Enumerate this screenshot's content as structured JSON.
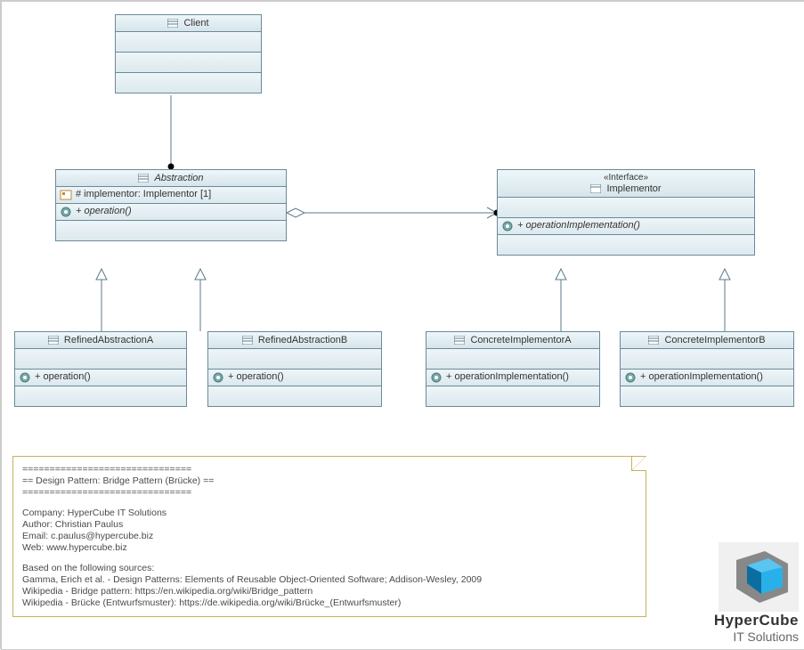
{
  "classes": {
    "client": {
      "name": "Client"
    },
    "abstraction": {
      "name": "Abstraction",
      "attr1": "# implementor: Implementor [1]",
      "op1": "+ operation()"
    },
    "implementor": {
      "stereo": "«Interface»",
      "name": "Implementor",
      "op1": "+ operationImplementation()"
    },
    "refinedA": {
      "name": "RefinedAbstractionA",
      "op1": "+ operation()"
    },
    "refinedB": {
      "name": "RefinedAbstractionB",
      "op1": "+ operation()"
    },
    "concreteA": {
      "name": "ConcreteImplementorA",
      "op1": "+ operationImplementation()"
    },
    "concreteB": {
      "name": "ConcreteImplementorB",
      "op1": "+ operationImplementation()"
    }
  },
  "note": {
    "line1": "===============================",
    "line2": "== Design Pattern: Bridge Pattern (Brücke) ==",
    "line3": "===============================",
    "line4": "Company: HyperCube IT Solutions",
    "line5": "Author: Christian Paulus",
    "line6": "Email: c.paulus@hypercube.biz",
    "line7": "Web: www.hypercube.biz",
    "line8": "Based on the following sources:",
    "line9": "Gamma, Erich et al. - Design Patterns: Elements of Reusable Object-Oriented Software; Addison-Wesley, 2009",
    "line10": "Wikipedia - Bridge pattern: https://en.wikipedia.org/wiki/Bridge_pattern",
    "line11": "Wikipedia - Brücke (Entwurfsmuster): https://de.wikipedia.org/wiki/Brücke_(Entwurfsmuster)"
  },
  "logo": {
    "line1": "HyperCube",
    "line2": "IT Solutions"
  },
  "chart_data": {
    "type": "uml-class-diagram",
    "pattern": "Bridge",
    "classes": [
      {
        "id": "Client",
        "stereotype": null,
        "abstract": false,
        "attributes": [],
        "operations": []
      },
      {
        "id": "Abstraction",
        "stereotype": null,
        "abstract": true,
        "attributes": [
          {
            "visibility": "#",
            "name": "implementor",
            "type": "Implementor",
            "multiplicity": "[1]"
          }
        ],
        "operations": [
          {
            "visibility": "+",
            "name": "operation()",
            "abstract": true
          }
        ]
      },
      {
        "id": "Implementor",
        "stereotype": "Interface",
        "abstract": true,
        "attributes": [],
        "operations": [
          {
            "visibility": "+",
            "name": "operationImplementation()",
            "abstract": true
          }
        ]
      },
      {
        "id": "RefinedAbstractionA",
        "stereotype": null,
        "abstract": false,
        "attributes": [],
        "operations": [
          {
            "visibility": "+",
            "name": "operation()"
          }
        ]
      },
      {
        "id": "RefinedAbstractionB",
        "stereotype": null,
        "abstract": false,
        "attributes": [],
        "operations": [
          {
            "visibility": "+",
            "name": "operation()"
          }
        ]
      },
      {
        "id": "ConcreteImplementorA",
        "stereotype": null,
        "abstract": false,
        "attributes": [],
        "operations": [
          {
            "visibility": "+",
            "name": "operationImplementation()"
          }
        ]
      },
      {
        "id": "ConcreteImplementorB",
        "stereotype": null,
        "abstract": false,
        "attributes": [],
        "operations": [
          {
            "visibility": "+",
            "name": "operationImplementation()"
          }
        ]
      }
    ],
    "relationships": [
      {
        "type": "association",
        "from": "Client",
        "to": "Abstraction",
        "navigable": true
      },
      {
        "type": "aggregation",
        "from": "Abstraction",
        "to": "Implementor",
        "navigable": true
      },
      {
        "type": "generalization",
        "from": "RefinedAbstractionA",
        "to": "Abstraction"
      },
      {
        "type": "generalization",
        "from": "RefinedAbstractionB",
        "to": "Abstraction"
      },
      {
        "type": "realization",
        "from": "ConcreteImplementorA",
        "to": "Implementor"
      },
      {
        "type": "realization",
        "from": "ConcreteImplementorB",
        "to": "Implementor"
      }
    ]
  }
}
